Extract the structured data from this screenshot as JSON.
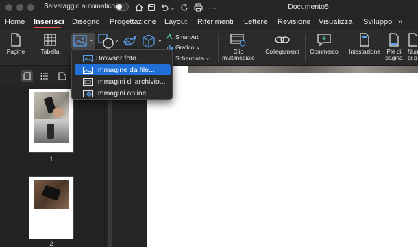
{
  "titlebar": {
    "autosave_label": "Salvataggio automatico",
    "document_title": "Documento5",
    "icons": [
      "home-icon",
      "save-icon",
      "undo-icon",
      "redo-icon",
      "print-icon",
      "more-icon"
    ]
  },
  "tabs": [
    "Home",
    "Inserisci",
    "Disegno",
    "Progettazione",
    "Layout",
    "Riferimenti",
    "Lettere",
    "Revisione",
    "Visualizza",
    "Sviluppo"
  ],
  "tabs_overflow": "»",
  "active_tab": "Inserisci",
  "ribbon": {
    "pages": "Pagine",
    "table": "Tabella",
    "smartart": "SmartArt",
    "chart": "Grafico",
    "screenshot": "Schermata",
    "clip_line1": "Clip",
    "clip_line2": "multimediale",
    "links": "Collegamenti",
    "comment": "Commento",
    "header": "Intestazione",
    "footer_line1": "Piè di",
    "footer_line2": "pagina",
    "pagenum_line1": "Nun",
    "pagenum_line2": "di p"
  },
  "picture_menu": {
    "items": [
      "Browser foto...",
      "Immagine da file...",
      "Immagini di archivio...",
      "Immagini online..."
    ],
    "highlighted": "Immagine da file..."
  },
  "sidebar": {
    "page_numbers": [
      "1",
      "2"
    ]
  },
  "colors": {
    "accent": "#e04a3d",
    "highlight": "#1f6fd6",
    "ribbon_bg": "#2b2b2b"
  }
}
